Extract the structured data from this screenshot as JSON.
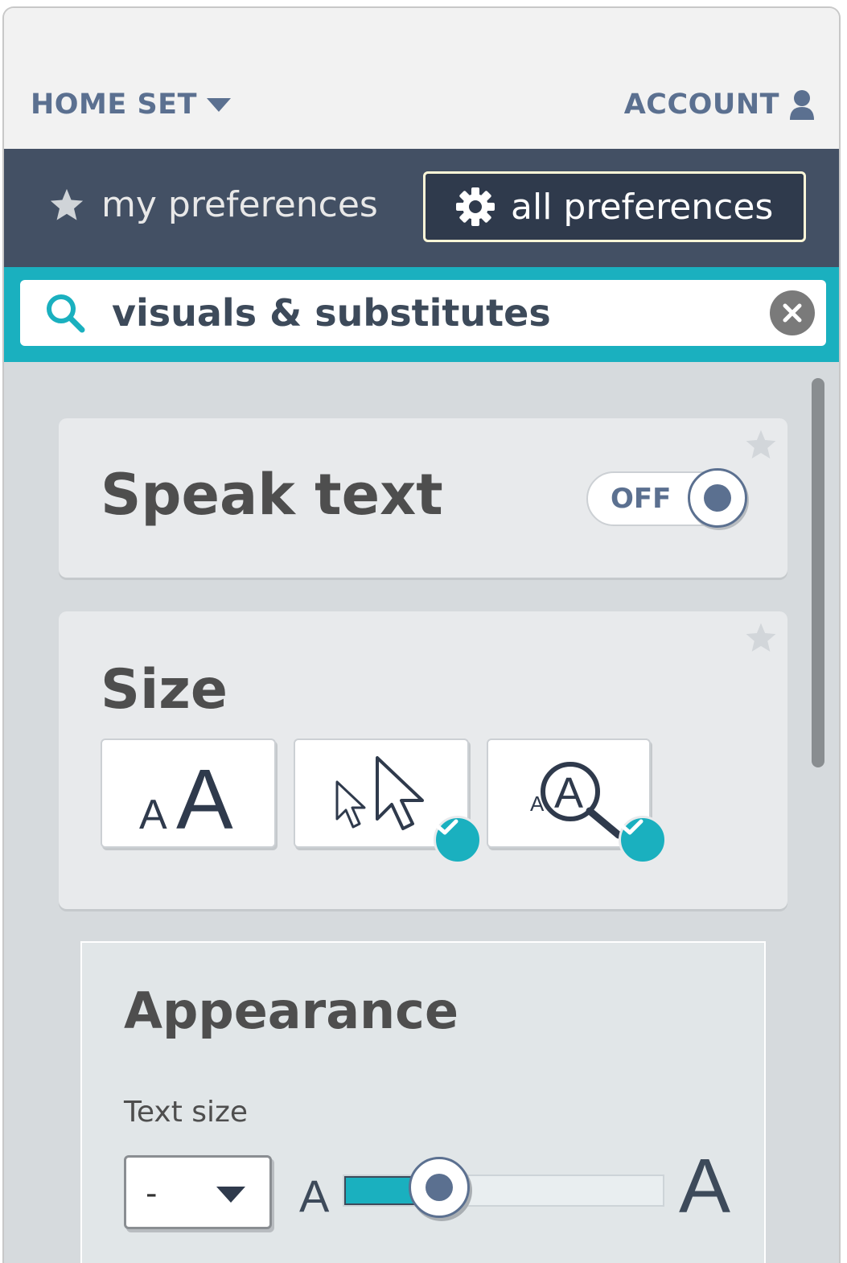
{
  "header": {
    "home_set_label": "HOME SET",
    "account_label": "ACCOUNT"
  },
  "tabs": {
    "my_preferences": "my preferences",
    "all_preferences": "all preferences",
    "active": "all preferences"
  },
  "search": {
    "value": "visuals & substitutes"
  },
  "cards": {
    "speak_text": {
      "title": "Speak text",
      "toggle_label": "OFF"
    },
    "size": {
      "title": "Size",
      "options": [
        {
          "icon": "text-size-icon",
          "checked": false
        },
        {
          "icon": "cursor-size-icon",
          "checked": true
        },
        {
          "icon": "magnifier-icon",
          "checked": true
        }
      ]
    }
  },
  "appearance": {
    "title": "Appearance",
    "text_size_label": "Text size",
    "dropdown_value": "-",
    "slider_min_label": "A",
    "slider_max_label": "A",
    "slider_fraction": 0.3
  },
  "colors": {
    "accent": "#1ab0bf",
    "nav_bg": "#435064",
    "label_blue": "#5b7090"
  }
}
